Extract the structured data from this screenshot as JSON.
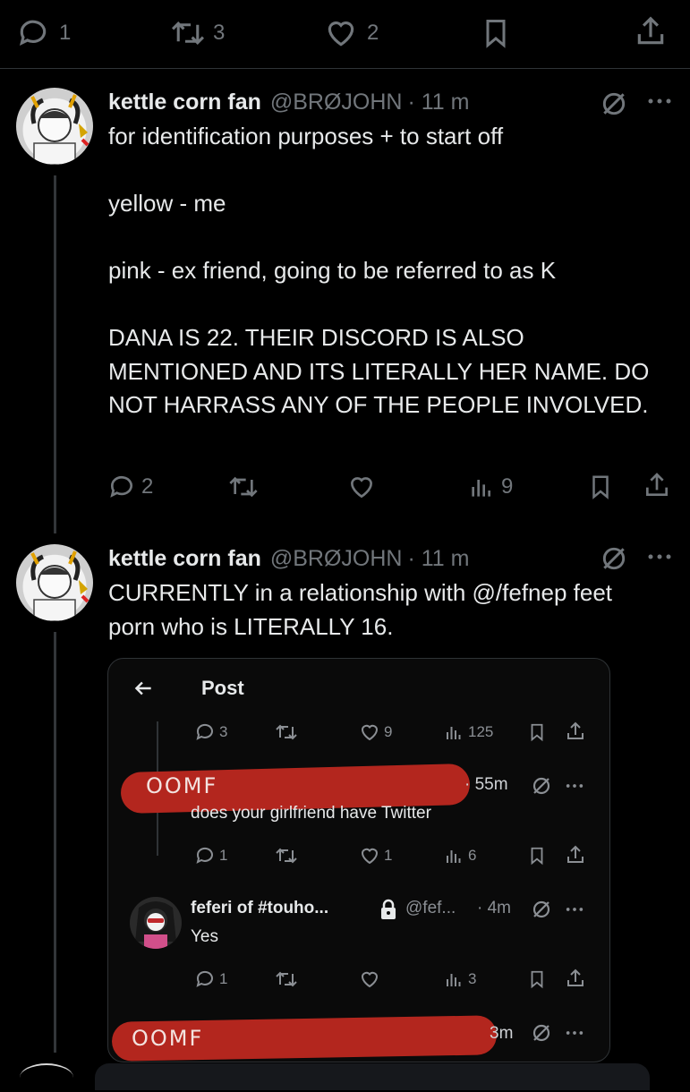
{
  "top_actions": {
    "replies": "1",
    "reposts": "3",
    "likes": "2"
  },
  "tweets": [
    {
      "name": "kettle corn fan",
      "handle": "@BRØJOHN",
      "time": "· 11 m",
      "text": "for identification purposes + to start off\n\nyellow - me\n\npink - ex friend, going to be referred to as K\n\nDANA IS 22. THEIR DISCORD IS ALSO MENTIONED AND ITS LITERALLY HER NAME. DO NOT HARRASS ANY OF THE PEOPLE INVOLVED.",
      "replies": "2",
      "views": "9"
    },
    {
      "name": "kettle corn fan",
      "handle": "@BRØJOHN",
      "time": "· 11 m",
      "text": "CURRENTLY in a relationship with @/fefnep feet porn who is LITERALLY 16."
    }
  ],
  "embed": {
    "header_title": "Post",
    "stats1": {
      "replies": "3",
      "likes": "9",
      "views": "125"
    },
    "reply1": {
      "scribble": "OOMF",
      "time": "· 55m",
      "text": "does your girlfriend have Twitter"
    },
    "stats2": {
      "replies": "1",
      "likes": "1",
      "views": "6"
    },
    "reply2": {
      "name": "feferi of #touho...",
      "handle": "@fef...",
      "time": "· 4m",
      "text": "Yes"
    },
    "stats3": {
      "replies": "1",
      "views": "3"
    },
    "reply3": {
      "scribble": "OOMF",
      "time": "3m"
    }
  },
  "colors": {
    "background": "#000000",
    "text": "#e7e9ea",
    "muted": "#71767b",
    "redaction": "#b3261e"
  }
}
